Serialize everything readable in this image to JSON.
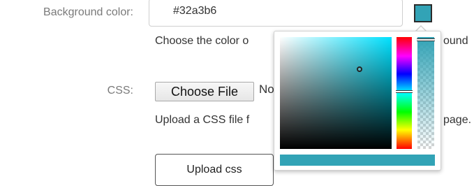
{
  "form": {
    "background_color": {
      "label": "Background color:",
      "value": "#32a3b6",
      "swatch_color": "#32a3b6",
      "help_left": "Choose the color o",
      "help_right": "ound"
    },
    "css": {
      "label": "CSS:",
      "choose_file_label": "Choose File",
      "no_file_text": "No",
      "help_left": "Upload a CSS file f",
      "help_right": "page."
    },
    "upload_button_label": "Upload css"
  },
  "color_picker": {
    "selected_color": "#32a3b6",
    "hue_color": "#00e1ff"
  }
}
